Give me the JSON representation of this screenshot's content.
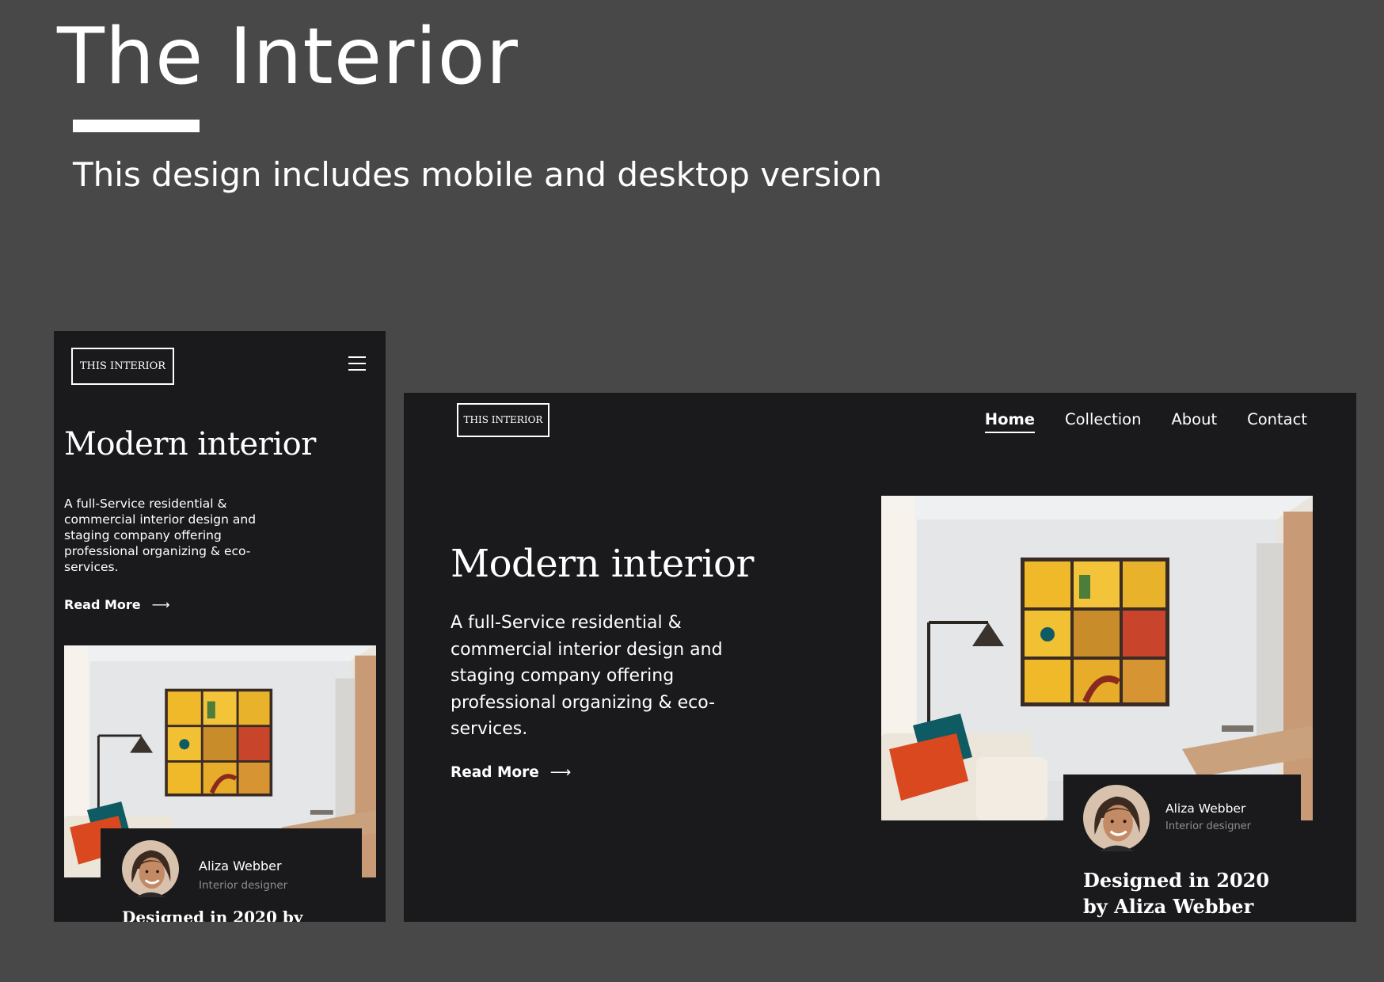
{
  "header": {
    "title": "The Interior",
    "subtitle": "This design includes mobile and desktop version"
  },
  "brand": {
    "logo_text": "THIS INTERIOR"
  },
  "mobile": {
    "menu_icon": "hamburger-menu-icon",
    "hero_title": "Modern interior",
    "hero_description": "A full-Service residential & commercial interior design and staging company offering professional organizing & eco-services.",
    "read_more": "Read More",
    "designer_name": "Aliza Webber",
    "designer_role": "Interior designer",
    "designed_text": "Designed in 2020 by"
  },
  "desktop": {
    "nav": [
      {
        "label": "Home",
        "active": true
      },
      {
        "label": "Collection",
        "active": false
      },
      {
        "label": "About",
        "active": false
      },
      {
        "label": "Contact",
        "active": false
      }
    ],
    "hero_title": "Modern interior",
    "hero_description": "A full-Service residential & commercial interior design and staging company offering professional organizing & eco-services.",
    "read_more": "Read More",
    "designer_name": "Aliza Webber",
    "designer_role": "Interior designer",
    "designed_text": "Designed in 2020 by Aliza Webber"
  },
  "colors": {
    "background": "#484848",
    "mockup_background": "#1a1a1c",
    "text": "#ffffff",
    "muted_text": "#8e8e8e",
    "accent_orange": "#d9481f",
    "accent_teal": "#0f5b63",
    "accent_yellow": "#f2c033"
  },
  "icons": {
    "arrow": "arrow-right-icon",
    "photo": "room-photo",
    "avatar": "designer-avatar"
  }
}
